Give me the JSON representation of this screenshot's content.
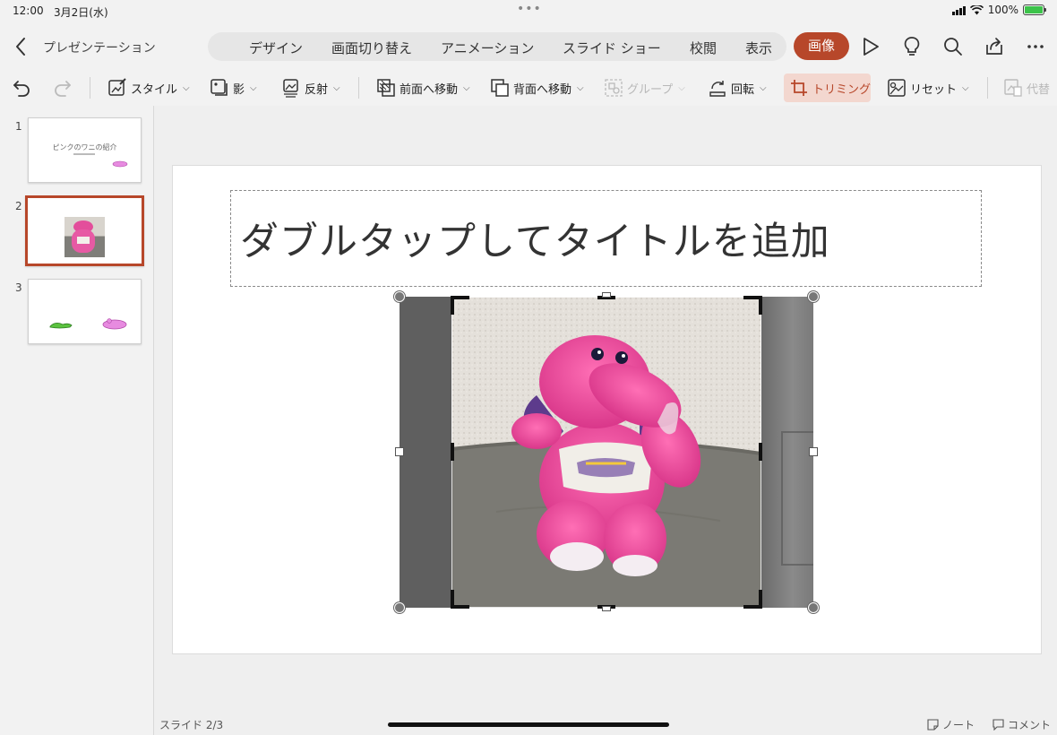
{
  "status_bar": {
    "time": "12:00",
    "date": "3月2日(水)",
    "battery": "100%"
  },
  "header": {
    "document_title": "プレゼンテーション",
    "tabs": [
      "デザイン",
      "画面切り替え",
      "アニメーション",
      "スライド ショー",
      "校閲",
      "表示"
    ],
    "active_tab": "画像",
    "icons": [
      "back-icon",
      "play-icon",
      "lightbulb-icon",
      "search-icon",
      "share-icon",
      "more-icon"
    ]
  },
  "toolbar": {
    "items": [
      {
        "label": "スタイル",
        "icon": "style-icon"
      },
      {
        "label": "影",
        "icon": "shadow-icon"
      },
      {
        "label": "反射",
        "icon": "reflection-icon"
      },
      {
        "label": "前面へ移動",
        "icon": "bring-forward-icon"
      },
      {
        "label": "背面へ移動",
        "icon": "send-backward-icon"
      },
      {
        "label": "グループ",
        "icon": "group-icon"
      },
      {
        "label": "回転",
        "icon": "rotate-icon"
      },
      {
        "label": "トリミング",
        "icon": "crop-icon"
      },
      {
        "label": "リセット",
        "icon": "reset-icon"
      },
      {
        "label": "代替",
        "icon": "alt-text-icon"
      }
    ]
  },
  "sidebar": {
    "slides": [
      {
        "number": "1",
        "title": "ピンクのワニの紹介"
      },
      {
        "number": "2",
        "title": ""
      },
      {
        "number": "3",
        "title": ""
      }
    ]
  },
  "slide": {
    "title_placeholder": "ダブルタップしてタイトルを追加"
  },
  "footer": {
    "slide_counter": "スライド 2/3",
    "notes": "ノート",
    "comments": "コメント"
  },
  "colors": {
    "accent": "#b7472a",
    "accent_light": "#f3d7cf"
  }
}
